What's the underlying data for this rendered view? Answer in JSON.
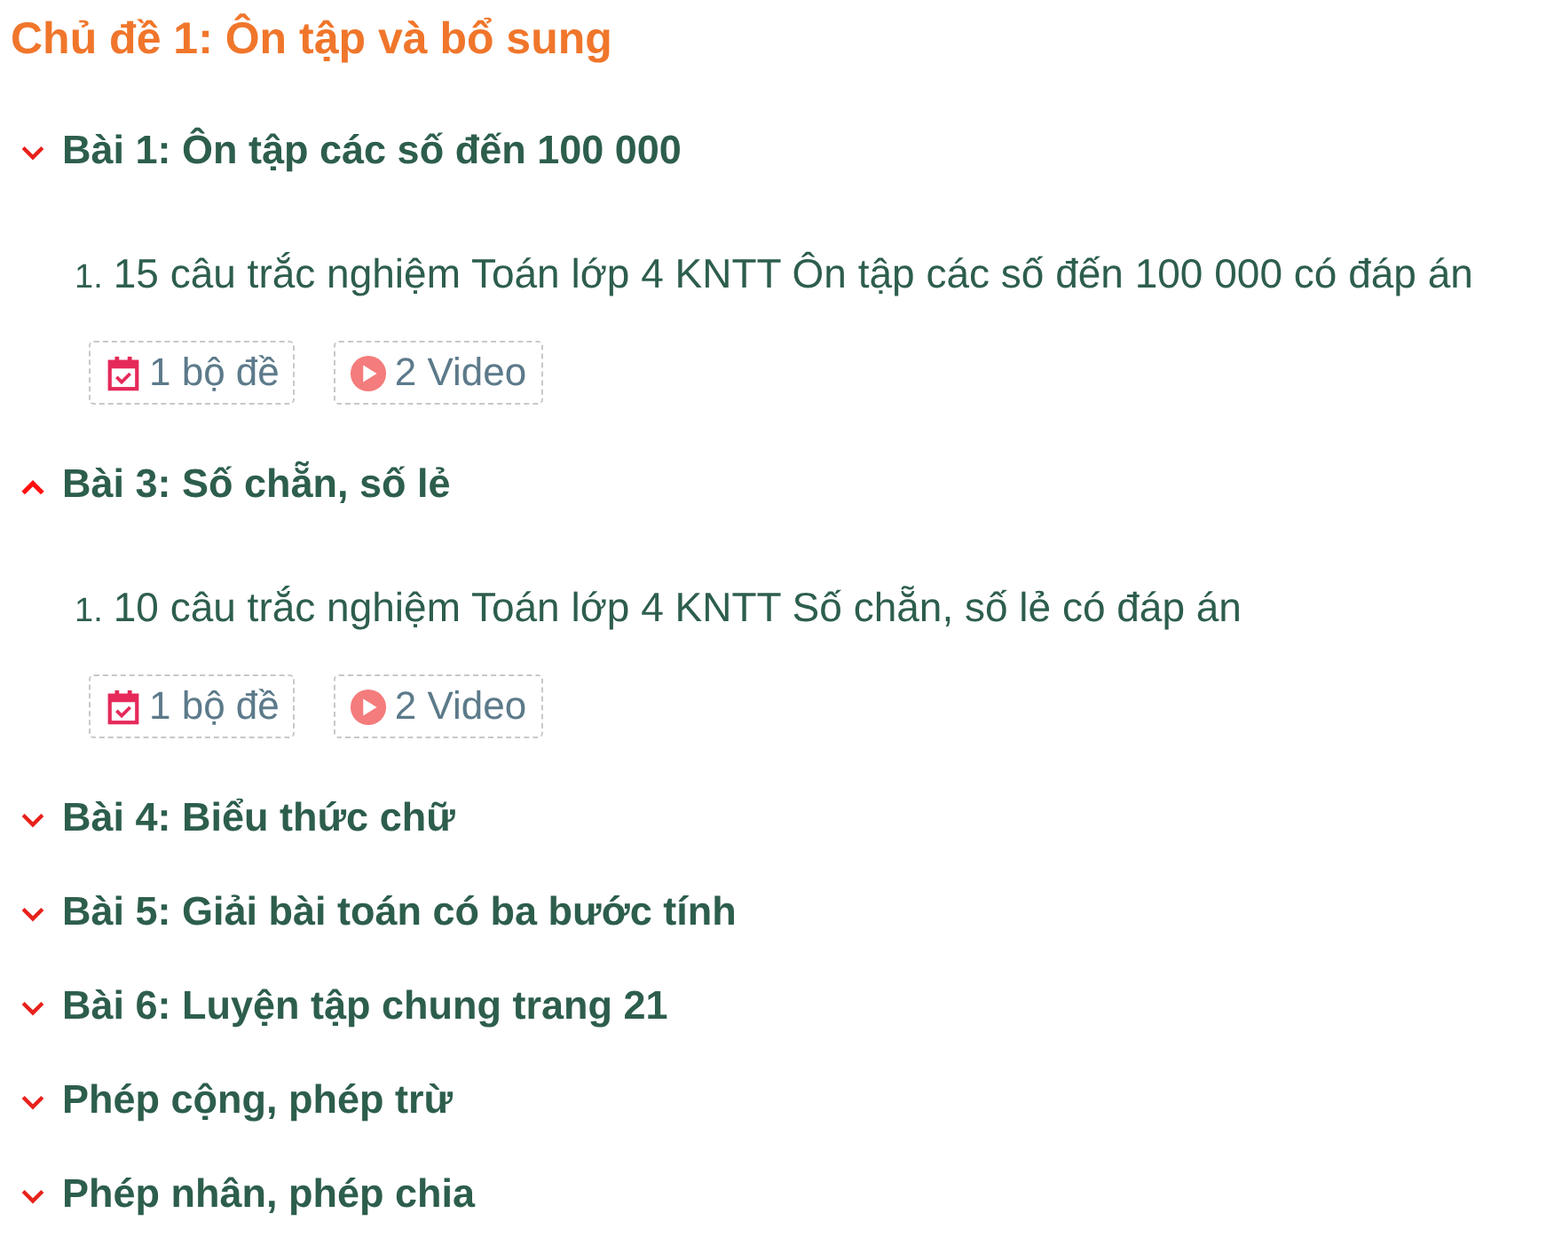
{
  "topic": {
    "title": "Chủ đề 1: Ôn tập và bổ sung"
  },
  "lessons": [
    {
      "title": "Bài 1: Ôn tập các số đến 100 000",
      "selected": false,
      "items": [
        {
          "number": "1.",
          "title": "15 câu trắc nghiệm Toán lớp 4 KNTT Ôn tập các số đến 100 000 có đáp án",
          "badges": [
            {
              "kind": "test",
              "label": "1 bộ đề"
            },
            {
              "kind": "video",
              "label": "2 Video"
            }
          ]
        }
      ]
    },
    {
      "title": "Bài 3: Số chẵn, số lẻ",
      "selected": true,
      "items": [
        {
          "number": "1.",
          "title": "10 câu trắc nghiệm Toán lớp 4 KNTT Số chẵn, số lẻ có đáp án",
          "badges": [
            {
              "kind": "test",
              "label": "1 bộ đề"
            },
            {
              "kind": "video",
              "label": "2 Video"
            }
          ]
        }
      ]
    },
    {
      "title": "Bài 4: Biểu thức chữ",
      "selected": false
    },
    {
      "title": "Bài 5: Giải bài toán có ba bước tính",
      "selected": false
    },
    {
      "title": "Bài 6: Luyện tập chung trang 21",
      "selected": false
    },
    {
      "title": "Phép cộng, phép trừ",
      "selected": false
    },
    {
      "title": "Phép nhân, phép chia",
      "selected": false
    }
  ]
}
